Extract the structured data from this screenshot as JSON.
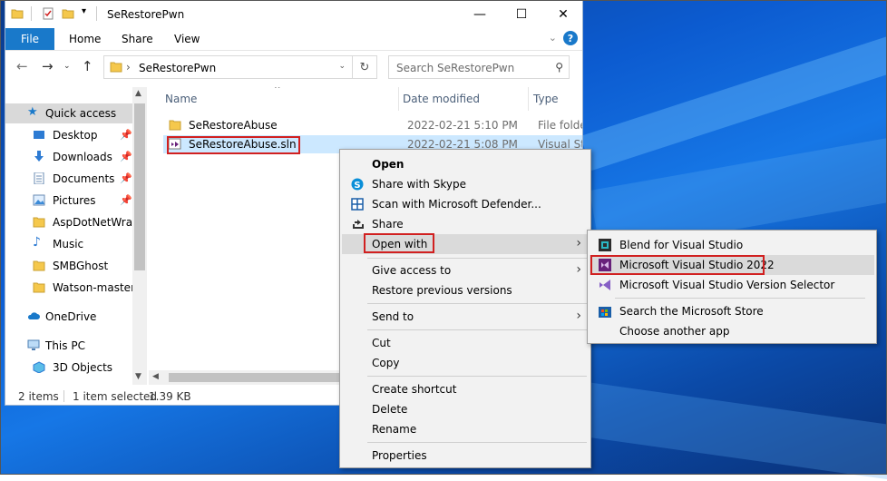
{
  "window": {
    "title": "SeRestorePwn",
    "minimize": "—",
    "maximize": "☐",
    "close": "✕"
  },
  "ribbon": {
    "file_tab": "File",
    "tabs": [
      "Home",
      "Share",
      "View"
    ]
  },
  "nav": {
    "address": "SeRestorePwn",
    "search_placeholder": "Search SeRestorePwn"
  },
  "navpane": {
    "quick_access": "Quick access",
    "pinned": [
      "Desktop",
      "Downloads",
      "Documents",
      "Pictures"
    ],
    "folders": [
      "AspDotNetWrap",
      "Music",
      "SMBGhost",
      "Watson-master"
    ],
    "onedrive": "OneDrive",
    "this_pc": "This PC",
    "objects_3d": "3D Objects"
  },
  "filelist": {
    "columns": [
      "Name",
      "Date modified",
      "Type"
    ],
    "rows": [
      {
        "name": "SeRestoreAbuse",
        "date": "2022-02-21 5:10 PM",
        "type": "File folder"
      },
      {
        "name": "SeRestoreAbuse.sln",
        "date": "2022-02-21 5:08 PM",
        "type": "Visual Stud"
      }
    ]
  },
  "status": {
    "items": "2 items",
    "selected": "1 item selected",
    "size": "1.39 KB"
  },
  "context_menu": {
    "open": "Open",
    "share_skype": "Share with Skype",
    "scan_defender": "Scan with Microsoft Defender...",
    "share": "Share",
    "open_with": "Open with",
    "give_access": "Give access to",
    "restore_versions": "Restore previous versions",
    "send_to": "Send to",
    "cut": "Cut",
    "copy": "Copy",
    "create_shortcut": "Create shortcut",
    "delete": "Delete",
    "rename": "Rename",
    "properties": "Properties"
  },
  "open_with_menu": {
    "blend": "Blend for Visual Studio",
    "vs2022": "Microsoft Visual Studio 2022",
    "vs_selector": "Microsoft Visual Studio Version Selector",
    "store": "Search the Microsoft Store",
    "another": "Choose another app"
  },
  "colors": {
    "accent": "#1979ca",
    "highlight_box": "#d12020",
    "selection": "#cce8ff",
    "folder": "#f5c84c",
    "vs_purple": "#68217a"
  }
}
